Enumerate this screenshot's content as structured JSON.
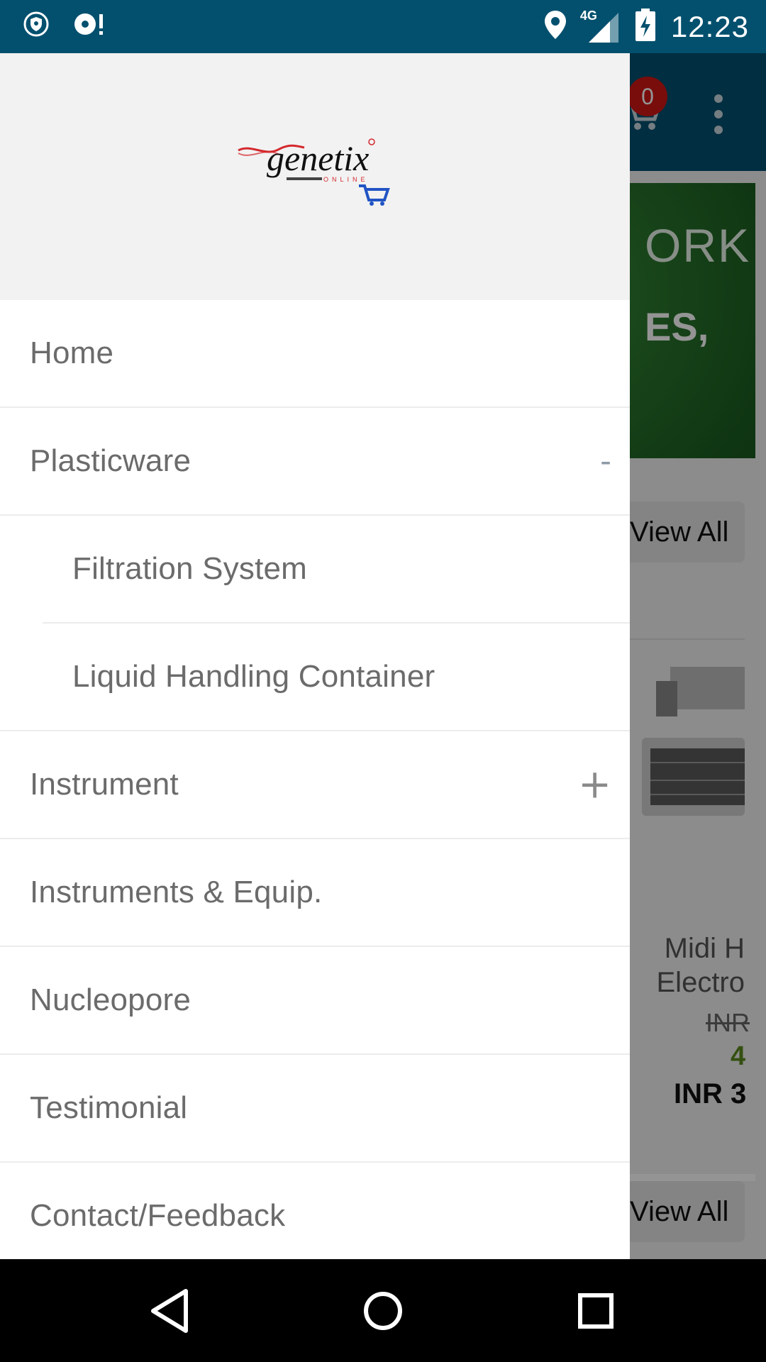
{
  "status_bar": {
    "time": "12:23",
    "network": "4G"
  },
  "app": {
    "cart_count": "0",
    "banner_line1": "ORK",
    "banner_line2": "ES,",
    "view_all_label": "View All",
    "product": {
      "name_line1": "Midi H",
      "name_line2": "Electro",
      "old_price": "INR",
      "discount": "4",
      "price": "INR 3"
    }
  },
  "drawer": {
    "logo_text": "genetix",
    "logo_subtext": "ONLINE",
    "menu": [
      {
        "label": "Home"
      },
      {
        "label": "Plasticware",
        "toggle": "-"
      },
      {
        "label": "Filtration System"
      },
      {
        "label": "Liquid Handling Container"
      },
      {
        "label": "Instrument",
        "toggle": "+"
      },
      {
        "label": "Instruments & Equip."
      },
      {
        "label": "Nucleopore"
      },
      {
        "label": "Testimonial"
      },
      {
        "label": "Contact/Feedback"
      }
    ]
  },
  "colors": {
    "primary": "#03506e",
    "badge": "#d01716",
    "drawer_header": "#f2f2f2",
    "menu_text": "#6b6b6b"
  }
}
